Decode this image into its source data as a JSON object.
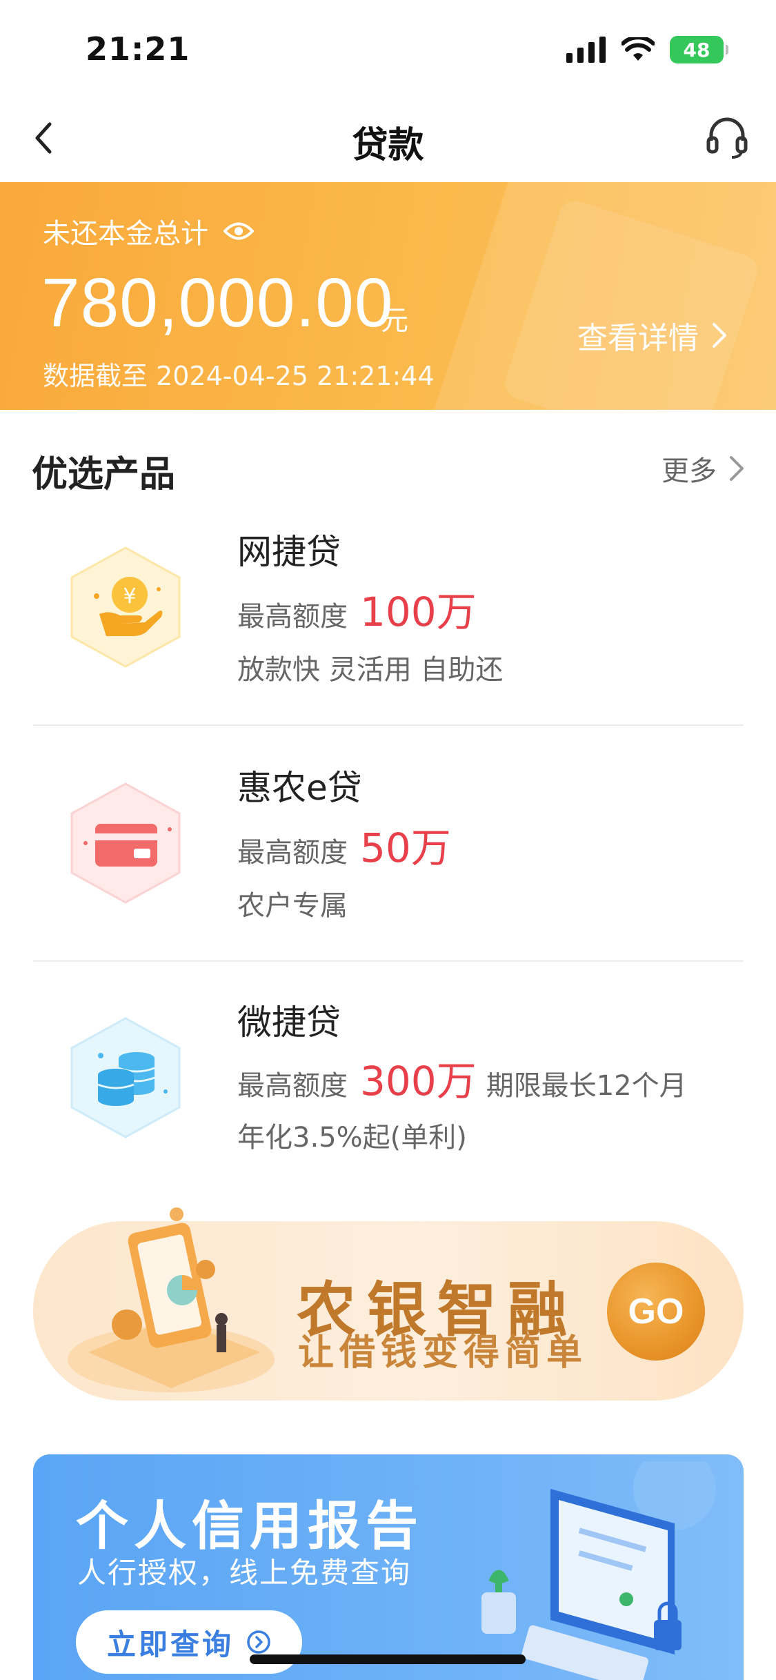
{
  "status_bar": {
    "time": "21:21",
    "battery": "48"
  },
  "nav": {
    "title": "贷款"
  },
  "balance": {
    "label": "未还本金总计",
    "amount": "780,000.00",
    "unit": "元",
    "updated": "数据截至 2024-04-25 21:21:44",
    "detail_label": "查看详情"
  },
  "section": {
    "title": "优选产品",
    "more": "更多"
  },
  "products": [
    {
      "name": "网捷贷",
      "limit_label": "最高额度",
      "limit": "100万",
      "extra": "",
      "desc": "放款快 灵活用 自助还",
      "icon": "hand-coin-icon",
      "color": "#fdc84a"
    },
    {
      "name": "惠农e贷",
      "limit_label": "最高额度",
      "limit": "50万",
      "extra": "",
      "desc": "农户专属",
      "icon": "card-icon",
      "color": "#f26a6a"
    },
    {
      "name": "微捷贷",
      "limit_label": "最高额度",
      "limit": "300万",
      "extra": "期限最长12个月",
      "desc": "年化3.5%起(单利)",
      "icon": "coins-stack-icon",
      "color": "#4cb8f0"
    }
  ],
  "promo": {
    "title": "农银智融",
    "subtitle": "让借钱变得简单",
    "go": "GO"
  },
  "credit": {
    "title": "个人信用报告",
    "subtitle": "人行授权，线上免费查询",
    "button": "立即查询"
  },
  "colors": {
    "accent_orange": "#f9a93a",
    "amount_red": "#e8404a",
    "credit_blue": "#5aa5f5"
  }
}
